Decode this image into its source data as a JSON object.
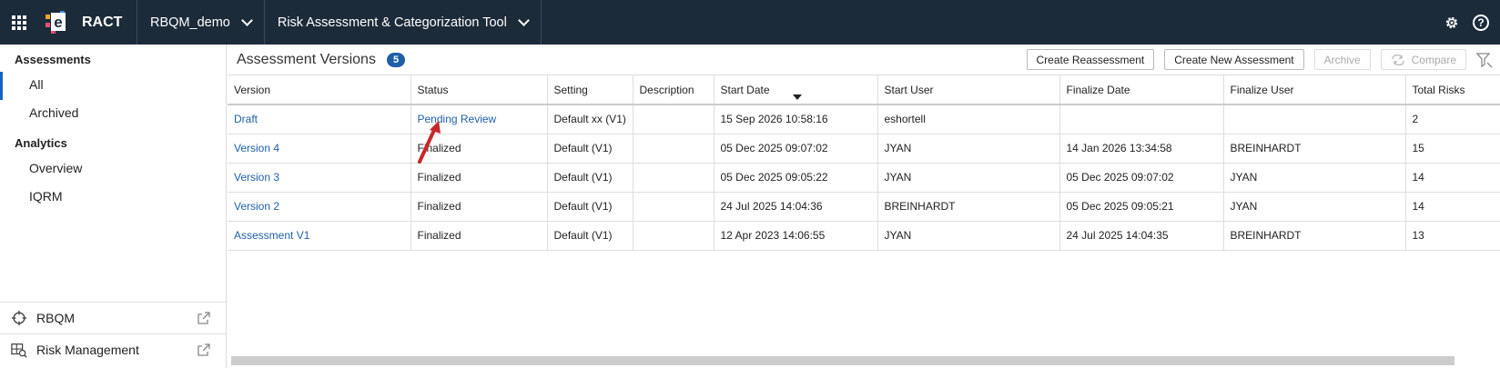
{
  "topbar": {
    "app_title": "RACT",
    "study": "RBQM_demo",
    "tool": "Risk Assessment & Categorization Tool",
    "help_glyph": "?"
  },
  "sidebar": {
    "section_assessments": "Assessments",
    "items_assessments": [
      "All",
      "Archived"
    ],
    "section_analytics": "Analytics",
    "items_analytics": [
      "Overview",
      "IQRM"
    ],
    "footer": [
      {
        "label": "RBQM",
        "icon": "crosshair-icon"
      },
      {
        "label": "Risk Management",
        "icon": "risk-management-icon"
      }
    ]
  },
  "main": {
    "title": "Assessment Versions",
    "count": "5",
    "buttons": {
      "create_reassessment": "Create Reassessment",
      "create_new": "Create New Assessment",
      "archive": "Archive",
      "compare": "Compare"
    },
    "columns": [
      "Version",
      "Status",
      "Setting",
      "Description",
      "Start Date",
      "Start User",
      "Finalize Date",
      "Finalize User",
      "Total Risks"
    ],
    "rows": [
      [
        "Draft",
        "Pending Review",
        "Default xx (V1)",
        "",
        "15 Sep 2026 10:58:16",
        "eshortell",
        "",
        "",
        "2"
      ],
      [
        "Version 4",
        "Finalized",
        "Default (V1)",
        "",
        "05 Dec 2025 09:07:02",
        "JYAN",
        "14 Jan 2026 13:34:58",
        "BREINHARDT",
        "15"
      ],
      [
        "Version 3",
        "Finalized",
        "Default (V1)",
        "",
        "05 Dec 2025 09:05:22",
        "JYAN",
        "05 Dec 2025 09:07:02",
        "JYAN",
        "14"
      ],
      [
        "Version 2",
        "Finalized",
        "Default (V1)",
        "",
        "24 Jul 2025 14:04:36",
        "BREINHARDT",
        "05 Dec 2025 09:05:21",
        "JYAN",
        "14"
      ],
      [
        "Assessment V1",
        "Finalized",
        "Default (V1)",
        "",
        "12 Apr 2023 14:06:55",
        "JYAN",
        "24 Jul 2025 14:04:35",
        "BREINHARDT",
        "13"
      ]
    ]
  },
  "colors": {
    "topbar_bg": "#1c2b3a",
    "link": "#1f5fa8",
    "badge": "#1f5fa8",
    "annotation_arrow": "#c62828"
  }
}
